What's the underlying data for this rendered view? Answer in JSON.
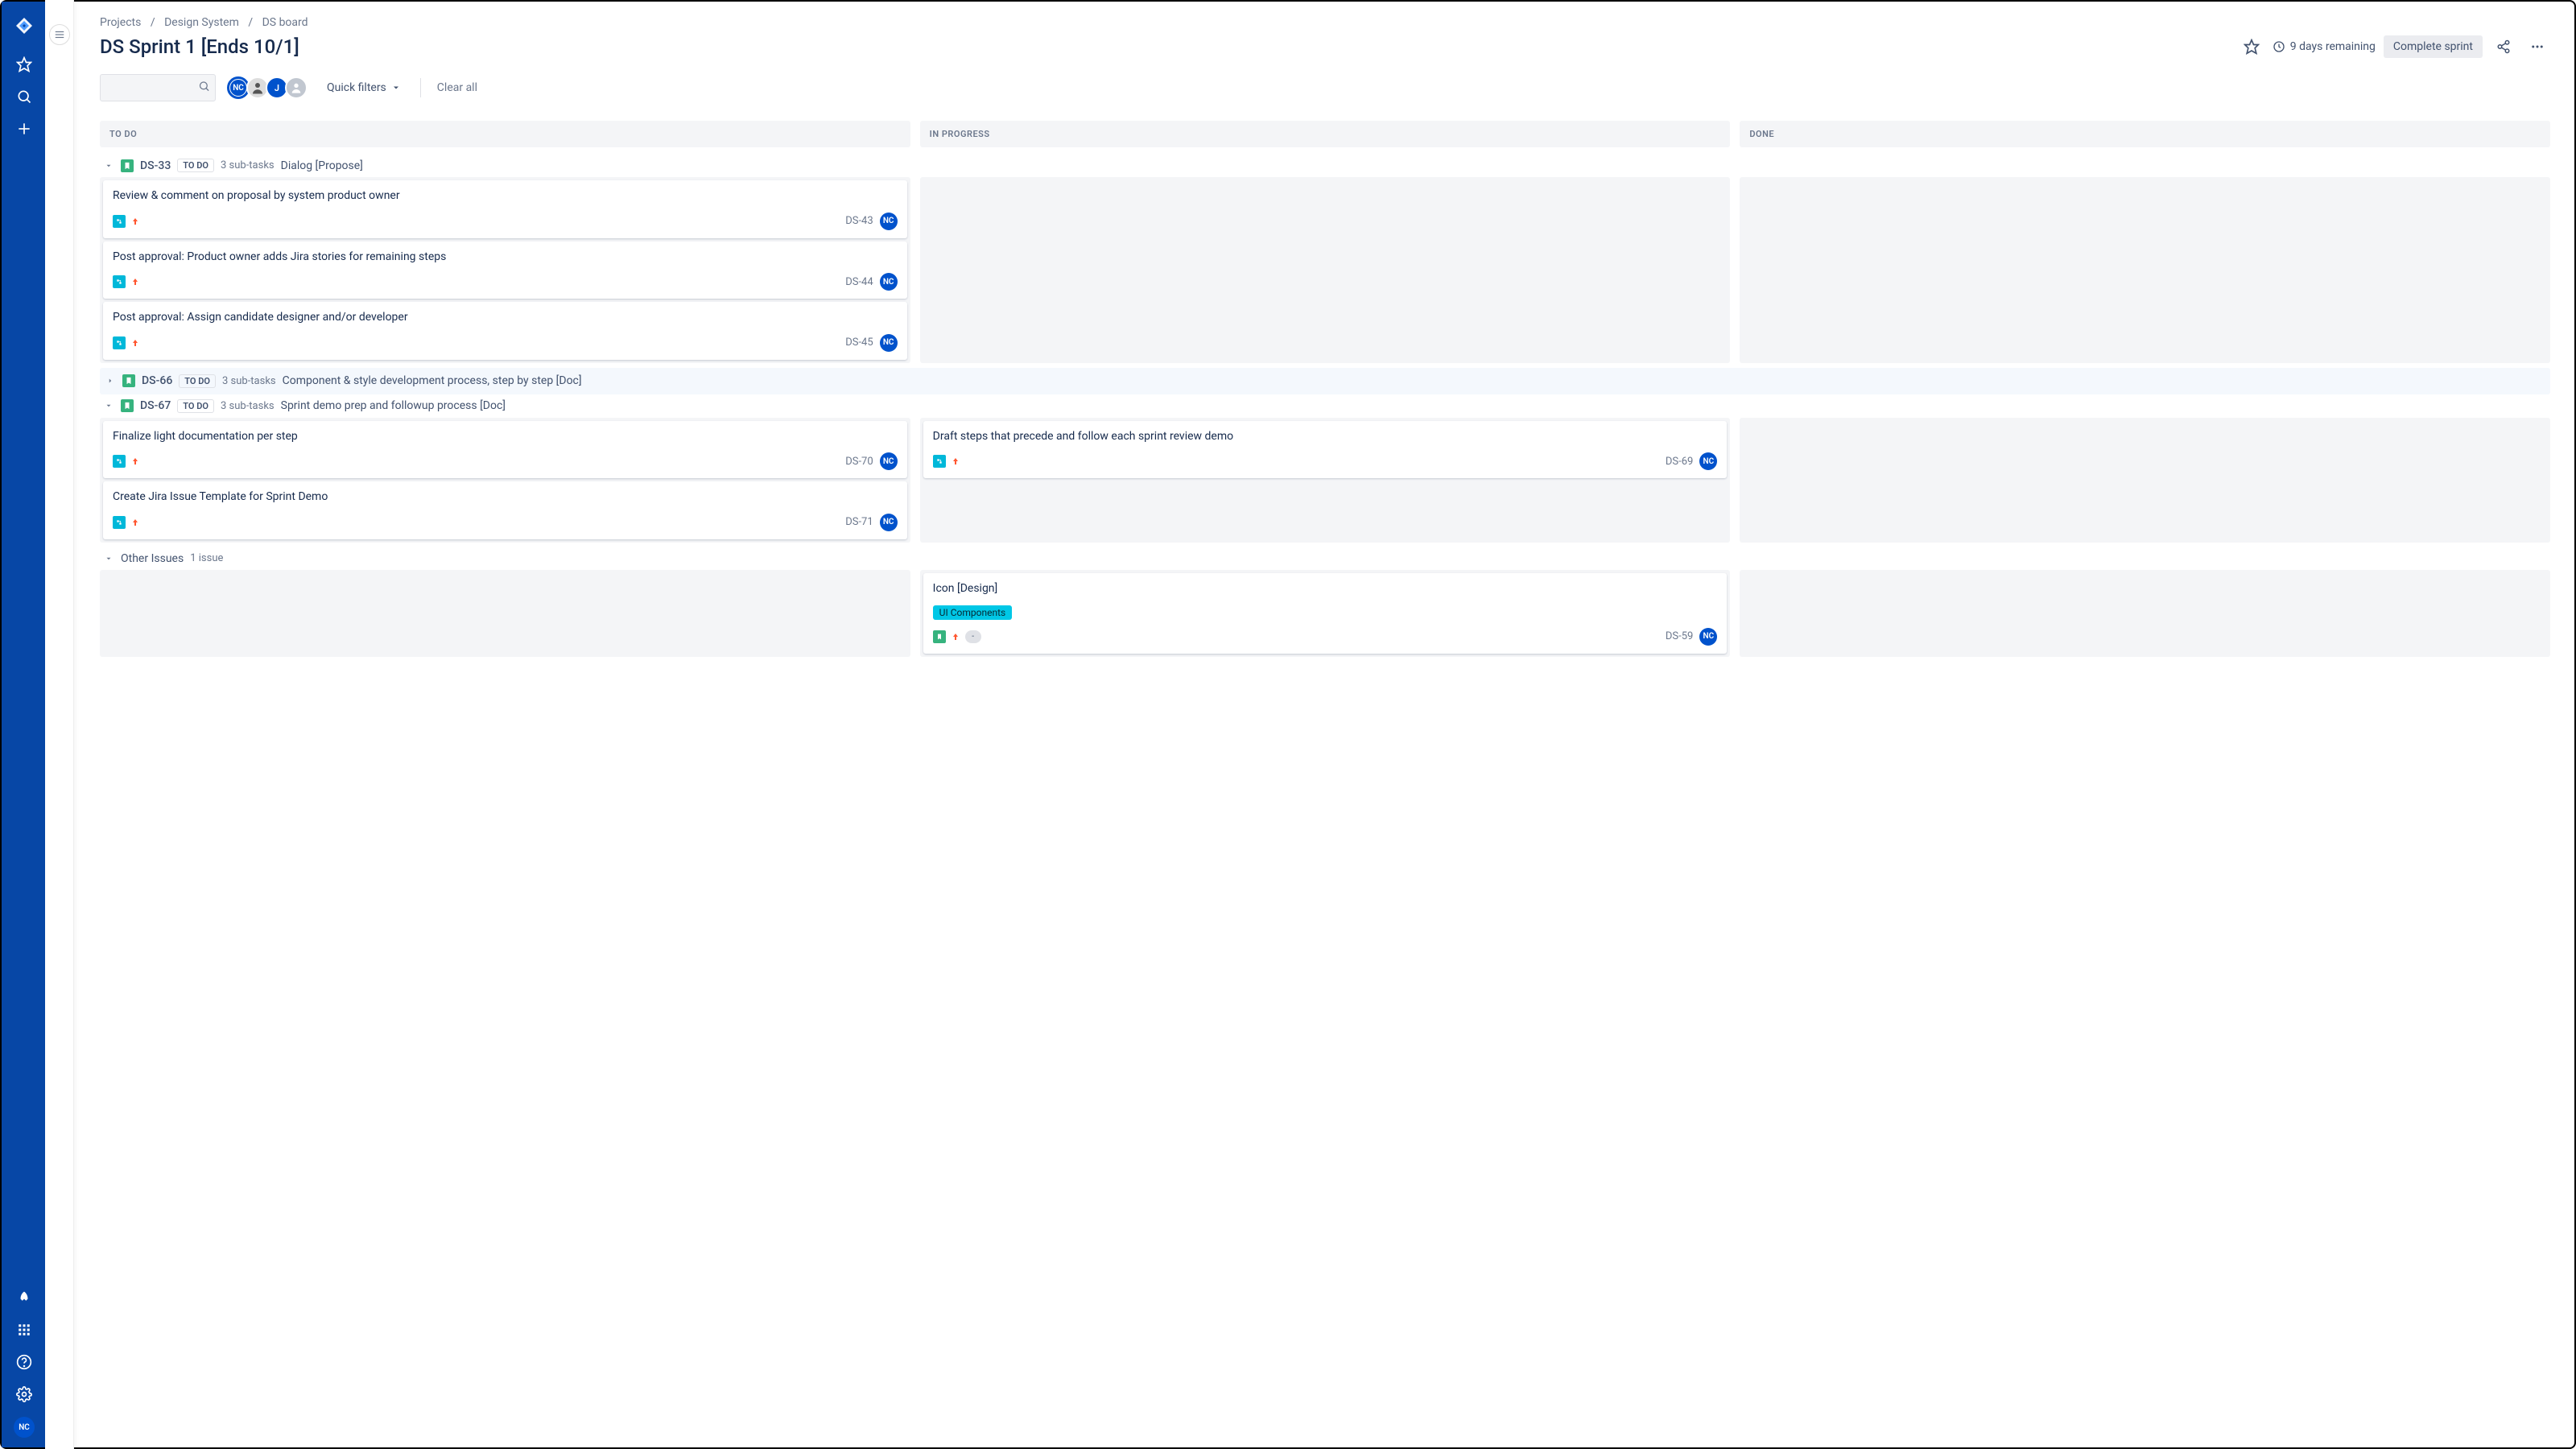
{
  "breadcrumb": {
    "items": [
      "Projects",
      "Design System",
      "DS board"
    ]
  },
  "sprint": {
    "title": "DS Sprint 1 [Ends 10/1]",
    "remaining_text": "9 days remaining",
    "complete_label": "Complete sprint"
  },
  "filters": {
    "quick_label": "Quick filters",
    "clear_label": "Clear all",
    "search_placeholder": ""
  },
  "avatars": {
    "nc": "NC",
    "j": "J"
  },
  "columns": {
    "todo": "TO DO",
    "inprogress": "IN PROGRESS",
    "done": "DONE"
  },
  "swimlanes": [
    {
      "id": "DS-33",
      "status": "TO DO",
      "subtask_text": "3 sub-tasks",
      "title": "Dialog [Propose]",
      "expanded": true,
      "cards": {
        "todo": [
          {
            "title": "Review & comment on proposal by system product owner",
            "key": "DS-43",
            "assignee": "NC",
            "type": "subtask",
            "priority": "high"
          },
          {
            "title": "Post approval: Product owner adds Jira stories for remaining steps",
            "key": "DS-44",
            "assignee": "NC",
            "type": "subtask",
            "priority": "high"
          },
          {
            "title": "Post approval: Assign candidate designer and/or developer",
            "key": "DS-45",
            "assignee": "NC",
            "type": "subtask",
            "priority": "high"
          }
        ],
        "inprogress": [],
        "done": []
      }
    },
    {
      "id": "DS-66",
      "status": "TO DO",
      "subtask_text": "3 sub-tasks",
      "title": "Component & style development process, step by step [Doc]",
      "expanded": false
    },
    {
      "id": "DS-67",
      "status": "TO DO",
      "subtask_text": "3 sub-tasks",
      "title": "Sprint demo prep and followup process [Doc]",
      "expanded": true,
      "cards": {
        "todo": [
          {
            "title": "Finalize light documentation per step",
            "key": "DS-70",
            "assignee": "NC",
            "type": "subtask",
            "priority": "high"
          },
          {
            "title": "Create Jira Issue Template for Sprint Demo",
            "key": "DS-71",
            "assignee": "NC",
            "type": "subtask",
            "priority": "high"
          }
        ],
        "inprogress": [
          {
            "title": "Draft steps that precede and follow each sprint review demo",
            "key": "DS-69",
            "assignee": "NC",
            "type": "subtask",
            "priority": "high"
          }
        ],
        "done": []
      }
    }
  ],
  "other": {
    "header": "Other Issues",
    "count_text": "1 issue",
    "cards": {
      "todo": [],
      "done": [],
      "inprogress": [
        {
          "title": "Icon [Design]",
          "label": "UI Components",
          "key": "DS-59",
          "assignee": "NC",
          "type": "story",
          "priority": "high",
          "estimate": "-"
        }
      ]
    }
  },
  "icons": {
    "jira": "jira-logo",
    "star": "star",
    "search": "search",
    "plus": "plus",
    "rocket": "rocket",
    "apps": "app-switcher",
    "help": "help",
    "settings": "settings"
  },
  "colors": {
    "nav_bg": "#0747A6",
    "primary": "#0052CC",
    "green": "#36B37E",
    "cyan": "#00B8D9",
    "label": "#00C7E6",
    "orange": "#FF5630"
  }
}
